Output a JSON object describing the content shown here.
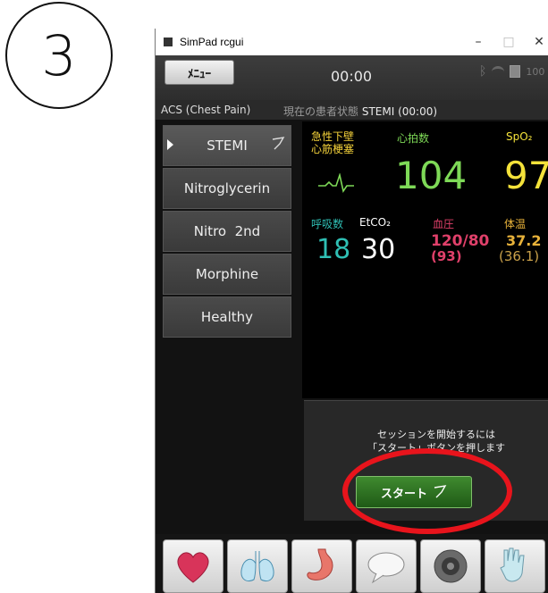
{
  "step_number": "3",
  "window": {
    "title": "SimPad rcgui",
    "controls": {
      "minimize": "–",
      "maximize": "□",
      "close": "✕"
    }
  },
  "appbar": {
    "menu_label": "ﾒﾆｭｰ",
    "clock": "00:00",
    "battery_text": "100",
    "icons": [
      "bluetooth-icon",
      "wifi-icon",
      "battery-icon"
    ]
  },
  "infobar": {
    "scenario": "ACS (Chest Pain)",
    "state_label": "現在の患者状態",
    "state_value": "STEMI (00:00)"
  },
  "sidebar": {
    "items": [
      {
        "label": "STEMI",
        "active": true,
        "flag": true
      },
      {
        "label": "Nitroglycerin"
      },
      {
        "label": "Nitro  2nd"
      },
      {
        "label": "Morphine"
      },
      {
        "label": "Healthy"
      }
    ]
  },
  "monitor": {
    "rhythm_label_1": "急性下壁",
    "rhythm_label_2": "心筋梗塞",
    "hr_label": "心拍数",
    "hr_value": "104",
    "spo2_label": "SpO₂",
    "spo2_value": "97",
    "rr_label": "呼吸数",
    "rr_value": "18",
    "etco2_label": "EtCO₂",
    "etco2_value": "30",
    "bp_label": "血圧",
    "bp_value": "120/80",
    "bp_mean": "(93)",
    "temp_label": "体温",
    "temp_value": "37.2",
    "temp_secondary": "(36.1)",
    "colors": {
      "hr": "#7ed957",
      "spo2": "#f4e23a",
      "rr": "#2fbfb4",
      "etco2": "#ffffff",
      "bp": "#e0406a",
      "temp": "#e8b23a",
      "rhythm": "#f4d23a"
    }
  },
  "start_panel": {
    "message_line1": "セッションを開始するには",
    "message_line2": "「スタート」ボタンを押します",
    "start_label": "スタート"
  },
  "bottom_tools": [
    "heart-icon",
    "lungs-icon",
    "stomach-icon",
    "speech-bubble-icon",
    "speaker-icon",
    "glove-icon"
  ]
}
